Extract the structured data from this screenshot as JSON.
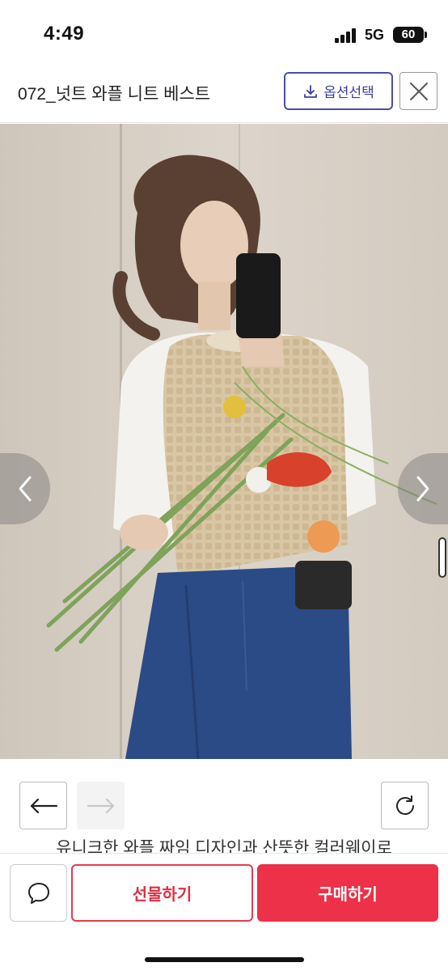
{
  "status_bar": {
    "time": "4:49",
    "network": "5G",
    "battery": "60"
  },
  "header": {
    "title": "072_넛트 와플 니트 베스트",
    "option_button": "옵션선택"
  },
  "photo": {
    "alt": ""
  },
  "description": "유니크한 와플 짜임 디자인과 산뜻한 컬러웨이로",
  "bottom_bar": {
    "gift_label": "선물하기",
    "buy_label": "구매하기"
  },
  "colors": {
    "accent_red": "#ec3148",
    "option_border": "#4a4fa8"
  },
  "icons": [
    "download-icon",
    "close-icon",
    "chevron-left-icon",
    "chevron-right-icon",
    "arrow-left-icon",
    "arrow-right-icon",
    "refresh-icon",
    "chat-bubble-icon"
  ]
}
